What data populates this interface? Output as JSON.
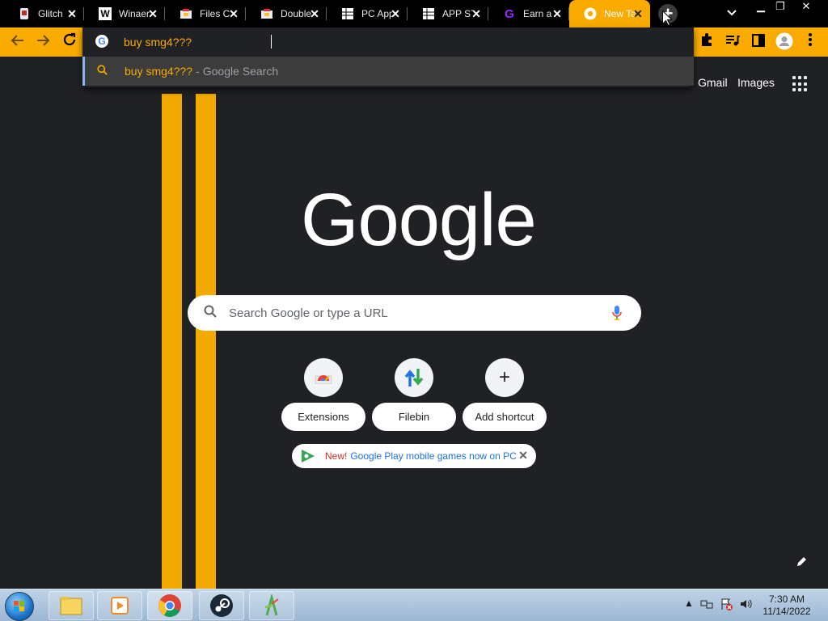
{
  "browser": {
    "tabs": [
      {
        "title": "Glitch",
        "icon": "glitch-icon"
      },
      {
        "title": "Winaero",
        "icon": "winaero-icon"
      },
      {
        "title": "Files Cl",
        "icon": "files-icon"
      },
      {
        "title": "Double",
        "icon": "double-icon"
      },
      {
        "title": "PC App",
        "icon": "sheet-icon"
      },
      {
        "title": "APP ST",
        "icon": "sheet-icon"
      },
      {
        "title": "Earn a",
        "icon": "earn-icon"
      },
      {
        "title": "New Tab",
        "icon": "chrome-icon",
        "active": true
      }
    ],
    "accent_color": "#f9ab00"
  },
  "omnibox": {
    "value": "buy smg4???",
    "suggestion": {
      "query": "buy smg4???",
      "dash": "-",
      "label": "Google Search"
    }
  },
  "ntp": {
    "links": {
      "gmail": "Gmail",
      "images": "Images"
    },
    "logo": "Google",
    "search_placeholder": "Search Google or type a URL",
    "shortcuts": [
      {
        "label": "Extensions",
        "icon": "chrome-web-store-icon"
      },
      {
        "label": "Filebin",
        "icon": "filebin-icon"
      },
      {
        "label": "Add shortcut",
        "icon": "plus-icon"
      }
    ],
    "promo": {
      "new_label": "New!",
      "text": "Google Play mobile games now on PC"
    }
  },
  "taskbar": {
    "clock_time": "7:30 AM",
    "clock_date": "11/14/2022"
  }
}
